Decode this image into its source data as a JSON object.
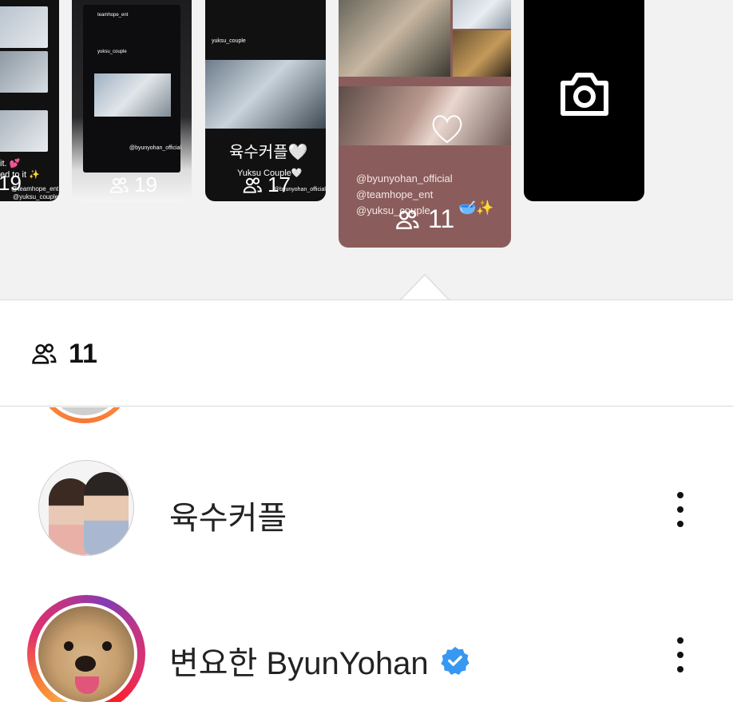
{
  "stories": [
    {
      "viewer_count": "19",
      "captions": [
        "it. 💕",
        "ed to it ✨",
        "@teamhope_ent",
        "@yuksu_couple"
      ]
    },
    {
      "viewer_count": "19",
      "header": "teamhope_ent",
      "inner_header": "yuksu_couple",
      "caption": "@byunyohan_official"
    },
    {
      "viewer_count": "17",
      "header": "yuksu_couple",
      "title": "육수커플🤍",
      "subtitle": "Yuksu Couple🤍",
      "caption": "@byunyohan_official"
    },
    {
      "viewer_count": "11",
      "handles": [
        "@byunyohan_official",
        "@teamhope_ent",
        "@yuksu_couple"
      ],
      "emoji": "🥣✨",
      "selected": true
    },
    {
      "type": "camera",
      "icon": "camera-icon"
    }
  ],
  "sheet": {
    "viewer_count": "11",
    "viewers_icon": "people-icon",
    "viewers": [
      {
        "name": "육수커플",
        "verified": false
      },
      {
        "name": "변요한 ByunYohan",
        "verified": true
      }
    ]
  },
  "colors": {
    "story_bg": "#f2f2f2",
    "selected_card": "#8a5d5c",
    "verified_blue": "#3897f0",
    "ring_gradient": [
      "#fcaf45",
      "#f77737",
      "#e1306c",
      "#c13584",
      "#833ab4"
    ]
  }
}
